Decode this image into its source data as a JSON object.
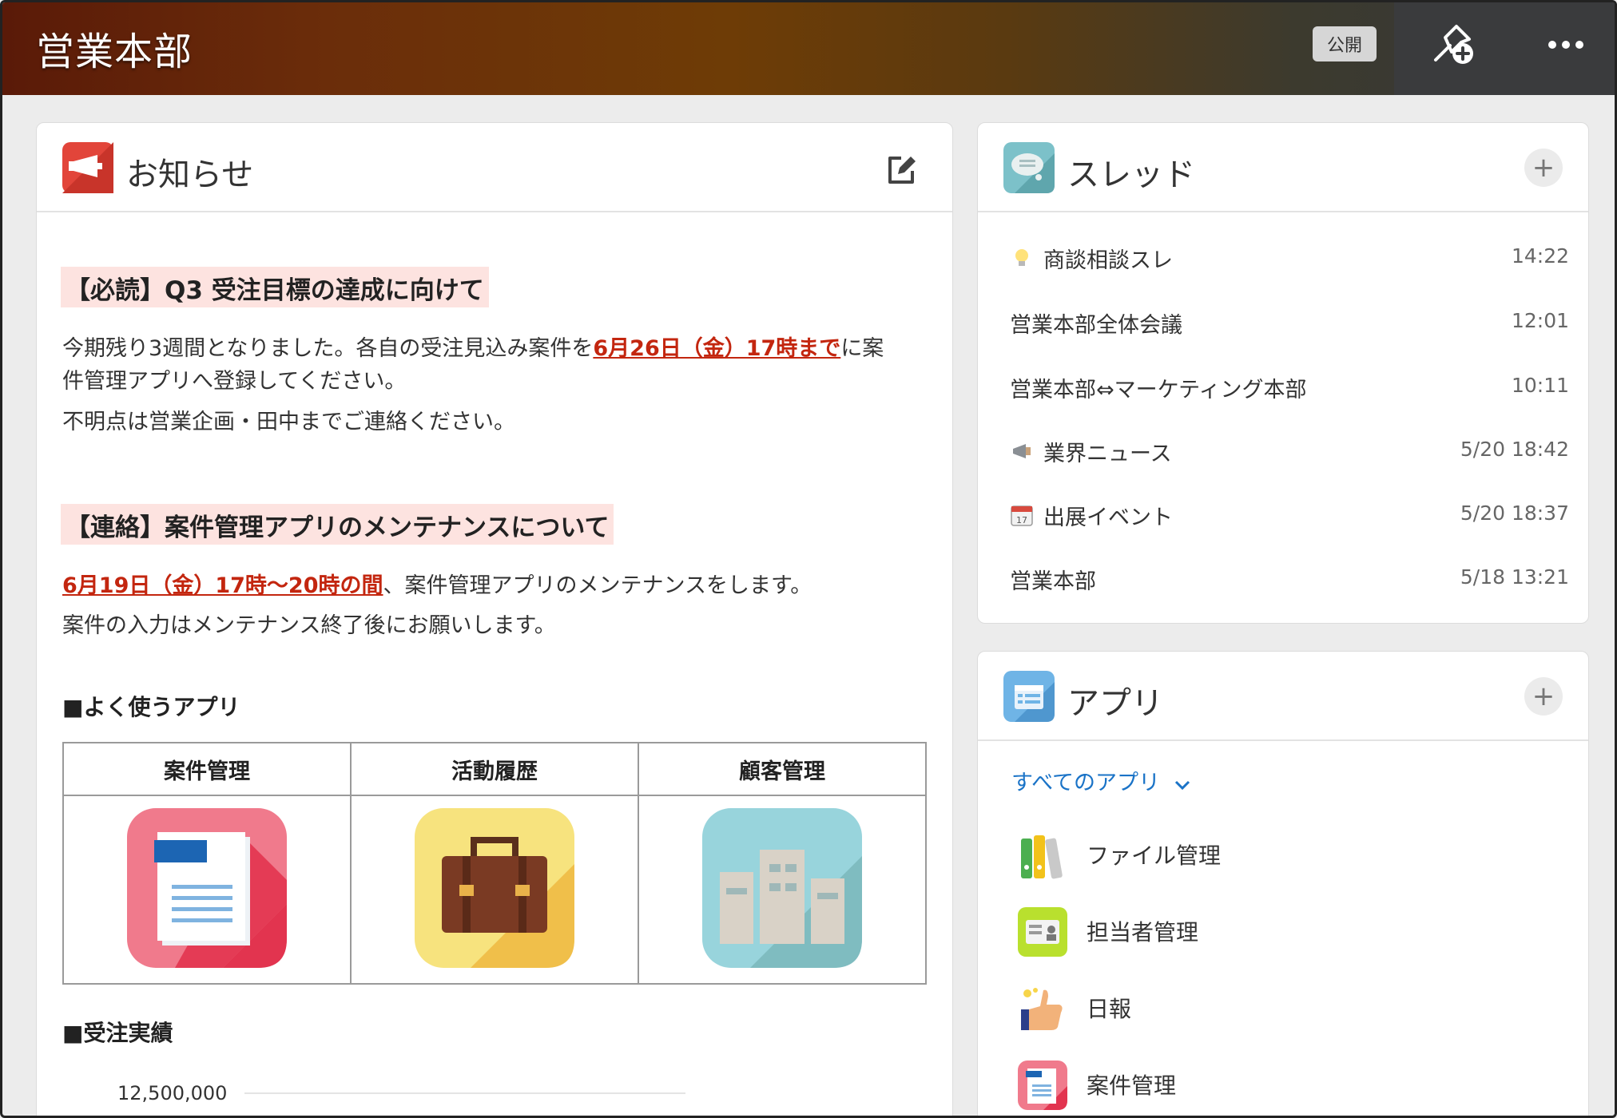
{
  "header": {
    "title": "営業本部",
    "public_badge": "公開",
    "pin_icon": "pin-plus-icon",
    "more_icon": "more-icon"
  },
  "notice": {
    "title": "お知らせ",
    "icon": "megaphone-icon",
    "edit_icon": "edit-icon",
    "item1": {
      "heading": "【必読】Q3 受注目標の達成に向けて",
      "line1_pre": "今期残り3週間となりました。各自の受注見込み案件を",
      "line1_red": "6月26日（金）17時まで",
      "line1_post": "に案",
      "line2": "件管理アプリへ登録してください。",
      "line3": "不明点は営業企画・田中までご連絡ください。"
    },
    "item2": {
      "heading": "【連絡】案件管理アプリのメンテナンスについて",
      "line1_red": "6月19日（金）17時～20時の間",
      "line1_post": "、案件管理アプリのメンテナンスをします。",
      "line2": "案件の入力はメンテナンス終了後にお願いします。"
    },
    "frequent_apps_heading": "■よく使うアプリ",
    "frequent_apps": [
      {
        "label": "案件管理",
        "icon": "document-icon"
      },
      {
        "label": "活動履歴",
        "icon": "briefcase-icon"
      },
      {
        "label": "顧客管理",
        "icon": "buildings-icon"
      }
    ],
    "orders_heading": "■受注実績",
    "chart_tick": "12,500,000"
  },
  "threads": {
    "title": "スレッド",
    "icon": "chat-bubble-icon",
    "add_icon": "plus-icon",
    "items": [
      {
        "name": "商談相談スレ",
        "time": "14:22",
        "icon": "lightbulb-icon"
      },
      {
        "name": "営業本部全体会議",
        "time": "12:01"
      },
      {
        "name": "営業本部⇔マーケティング本部",
        "time": "10:11"
      },
      {
        "name": "業界ニュース",
        "time": "5/20 18:42",
        "icon": "megaphone-icon"
      },
      {
        "name": "出展イベント",
        "time": "5/20 18:37",
        "icon": "calendar-icon"
      },
      {
        "name": "営業本部",
        "time": "5/18 13:21"
      }
    ]
  },
  "apps": {
    "title": "アプリ",
    "icon": "list-icon",
    "add_icon": "plus-icon",
    "filter_label": "すべてのアプリ",
    "items": [
      {
        "name": "ファイル管理",
        "icon": "binders-icon"
      },
      {
        "name": "担当者管理",
        "icon": "id-card-icon"
      },
      {
        "name": "日報",
        "icon": "thumbs-up-icon"
      },
      {
        "name": "案件管理",
        "icon": "document-icon"
      }
    ]
  },
  "colors": {
    "accent_red": "#c3260f",
    "link_blue": "#1a73c7",
    "heading_highlight": "#fde3e0"
  }
}
